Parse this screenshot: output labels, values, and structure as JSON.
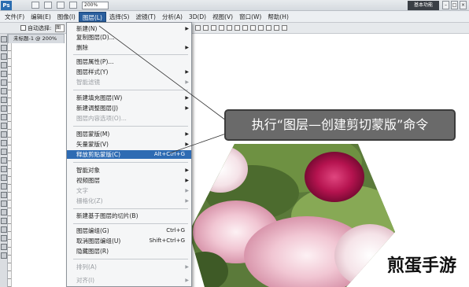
{
  "app": {
    "logo": "Ps",
    "zoom_level": "200%",
    "workspace_label": "基本功能",
    "window_buttons": [
      "–",
      "□",
      "×"
    ]
  },
  "menubar": {
    "items": [
      "文件(F)",
      "编辑(E)",
      "图像(I)",
      "图层(L)",
      "选择(S)",
      "滤镜(T)",
      "分析(A)",
      "3D(D)",
      "视图(V)",
      "窗口(W)",
      "帮助(H)"
    ],
    "active_index": 3
  },
  "options_bar": {
    "auto_select_label": "自动选择:",
    "select_value": "图"
  },
  "document": {
    "tab_title": "未标题-1 @ 200%"
  },
  "layer_menu": {
    "items": [
      {
        "label": "新建(N)",
        "shortcut": "",
        "arrow": true,
        "disabled": false,
        "highlight": false
      },
      {
        "label": "复制图层(D)...",
        "shortcut": "",
        "arrow": false,
        "disabled": false,
        "highlight": false
      },
      {
        "label": "删除",
        "shortcut": "",
        "arrow": true,
        "disabled": false,
        "highlight": false
      },
      {
        "label": "图层属性(P)...",
        "shortcut": "",
        "arrow": false,
        "disabled": false,
        "highlight": false
      },
      {
        "label": "图层样式(Y)",
        "shortcut": "",
        "arrow": true,
        "disabled": false,
        "highlight": false
      },
      {
        "label": "智能滤镜",
        "shortcut": "",
        "arrow": true,
        "disabled": true,
        "highlight": false
      },
      {
        "label": "新建填充图层(W)",
        "shortcut": "",
        "arrow": true,
        "disabled": false,
        "highlight": false
      },
      {
        "label": "新建调整图层(J)",
        "shortcut": "",
        "arrow": true,
        "disabled": false,
        "highlight": false
      },
      {
        "label": "图层内容选项(O)...",
        "shortcut": "",
        "arrow": false,
        "disabled": true,
        "highlight": false
      },
      {
        "label": "图层蒙版(M)",
        "shortcut": "",
        "arrow": true,
        "disabled": false,
        "highlight": false
      },
      {
        "label": "矢量蒙版(V)",
        "shortcut": "",
        "arrow": true,
        "disabled": false,
        "highlight": false
      },
      {
        "label": "释放剪贴蒙版(C)",
        "shortcut": "Alt+Ctrl+G",
        "arrow": false,
        "disabled": false,
        "highlight": true
      },
      {
        "label": "智能对象",
        "shortcut": "",
        "arrow": true,
        "disabled": false,
        "highlight": false
      },
      {
        "label": "视频图层",
        "shortcut": "",
        "arrow": true,
        "disabled": false,
        "highlight": false
      },
      {
        "label": "文字",
        "shortcut": "",
        "arrow": true,
        "disabled": true,
        "highlight": false
      },
      {
        "label": "栅格化(Z)",
        "shortcut": "",
        "arrow": true,
        "disabled": true,
        "highlight": false
      },
      {
        "label": "新建基于图层的切片(B)",
        "shortcut": "",
        "arrow": false,
        "disabled": false,
        "highlight": false
      },
      {
        "label": "图层编组(G)",
        "shortcut": "Ctrl+G",
        "arrow": false,
        "disabled": false,
        "highlight": false
      },
      {
        "label": "取消图层编组(U)",
        "shortcut": "Shift+Ctrl+G",
        "arrow": false,
        "disabled": false,
        "highlight": false
      },
      {
        "label": "隐藏图层(R)",
        "shortcut": "",
        "arrow": false,
        "disabled": false,
        "highlight": false
      },
      {
        "label": "排列(A)",
        "shortcut": "",
        "arrow": true,
        "disabled": true,
        "highlight": false
      },
      {
        "label": "对齐(I)",
        "shortcut": "",
        "arrow": true,
        "disabled": true,
        "highlight": false
      }
    ]
  },
  "callout": {
    "text": "执行“图层—创建剪切蒙版”命令"
  },
  "watermark": {
    "text": "煎蛋手游"
  },
  "colors": {
    "highlight": "#2e6bb3",
    "callout_bg": "#6a6a6a",
    "menubar_bg": "#eceff2"
  }
}
